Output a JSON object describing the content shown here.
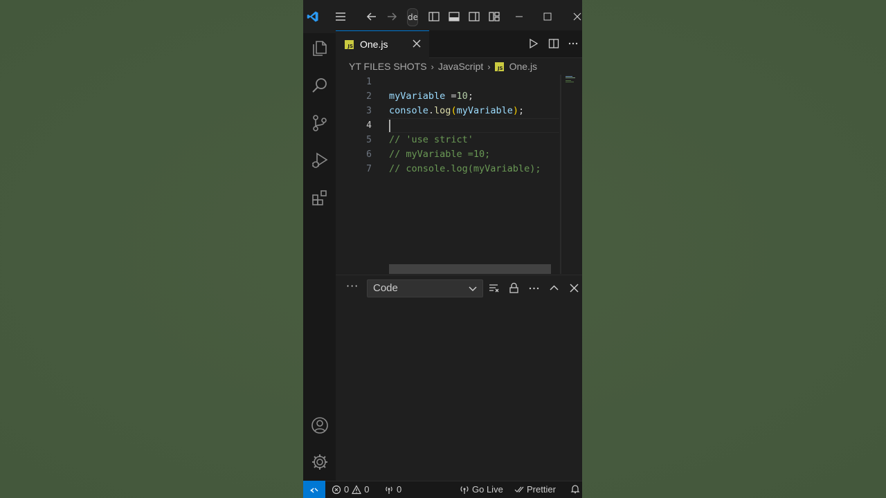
{
  "titlebar": {
    "command_center_text": "de"
  },
  "tab": {
    "label": "One.js",
    "icon_badge": "JS"
  },
  "breadcrumb": {
    "items": [
      "YT FILES SHOTS",
      "JavaScript",
      "One.js"
    ],
    "file_badge": "JS"
  },
  "editor": {
    "line_numbers": [
      "1",
      "2",
      "3",
      "4",
      "5",
      "6",
      "7"
    ],
    "active_line": "4",
    "lines": {
      "l2_var": "myVariable",
      "l2_rest": " =",
      "l2_num": "10",
      "l2_end": ";",
      "l3_obj": "console",
      "l3_dot": ".",
      "l3_fn": "log",
      "l3_open": "(",
      "l3_arg": "myVariable",
      "l3_close": ")",
      "l3_end": ";",
      "l5": "// 'use strict'",
      "l6": "// myVariable =10;",
      "l7": "// console.log(myVariable);"
    }
  },
  "panel": {
    "output_channel": "Code"
  },
  "statusbar": {
    "errors": "0",
    "warnings": "0",
    "ports": "0",
    "go_live": "Go Live",
    "prettier": "Prettier"
  },
  "colors": {
    "accent": "#0078d4",
    "background": "#1f1f1f",
    "page_bg": "#465a3e"
  }
}
